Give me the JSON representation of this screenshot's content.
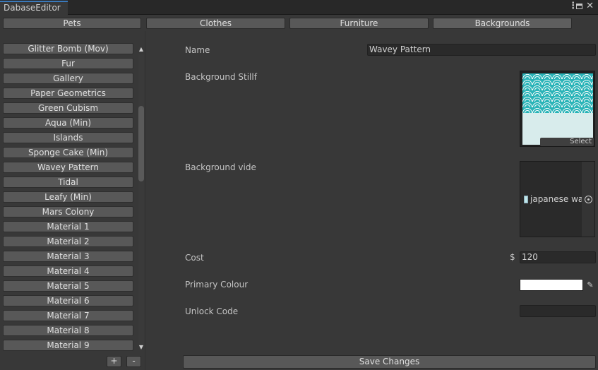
{
  "window": {
    "tab_title": "DabaseEditor",
    "icons": [
      "kebab-menu-icon",
      "maximize-icon",
      "close-icon"
    ]
  },
  "categories": [
    "Pets",
    "Clothes",
    "Furniture",
    "Backgrounds"
  ],
  "active_category": "Backgrounds",
  "list": {
    "items": [
      "Glitter Bomb (Mov)",
      "Fur",
      "Gallery",
      "Paper Geometrics",
      "Green Cubism",
      "Aqua (Min)",
      "Islands",
      "Sponge Cake (Min)",
      "Wavey Pattern",
      "Tidal",
      "Leafy (Min)",
      "Mars Colony",
      "Material 1",
      "Material 2",
      "Material 3",
      "Material 4",
      "Material 5",
      "Material 6",
      "Material 7",
      "Material 8",
      "Material 9"
    ],
    "add_label": "+",
    "remove_label": "-"
  },
  "form": {
    "name_label": "Name",
    "name_value": "Wavey Pattern",
    "still_label": "Background Stillf",
    "still_select_label": "Select",
    "video_label": "Background vide",
    "video_value": "japanese wav",
    "cost_label": "Cost",
    "cost_currency": "$",
    "cost_value": "120",
    "primary_colour_label": "Primary Colour",
    "primary_colour_value": "#ffffff",
    "unlock_label": "Unlock Code",
    "unlock_value": "",
    "save_label": "Save Changes"
  },
  "colors": {
    "background": "#383838",
    "titlebar": "#282828",
    "tab_accent": "#3a79bb",
    "button": "#585858",
    "field": "#2a2a2a",
    "pattern_teal": "#2ab4b8"
  }
}
